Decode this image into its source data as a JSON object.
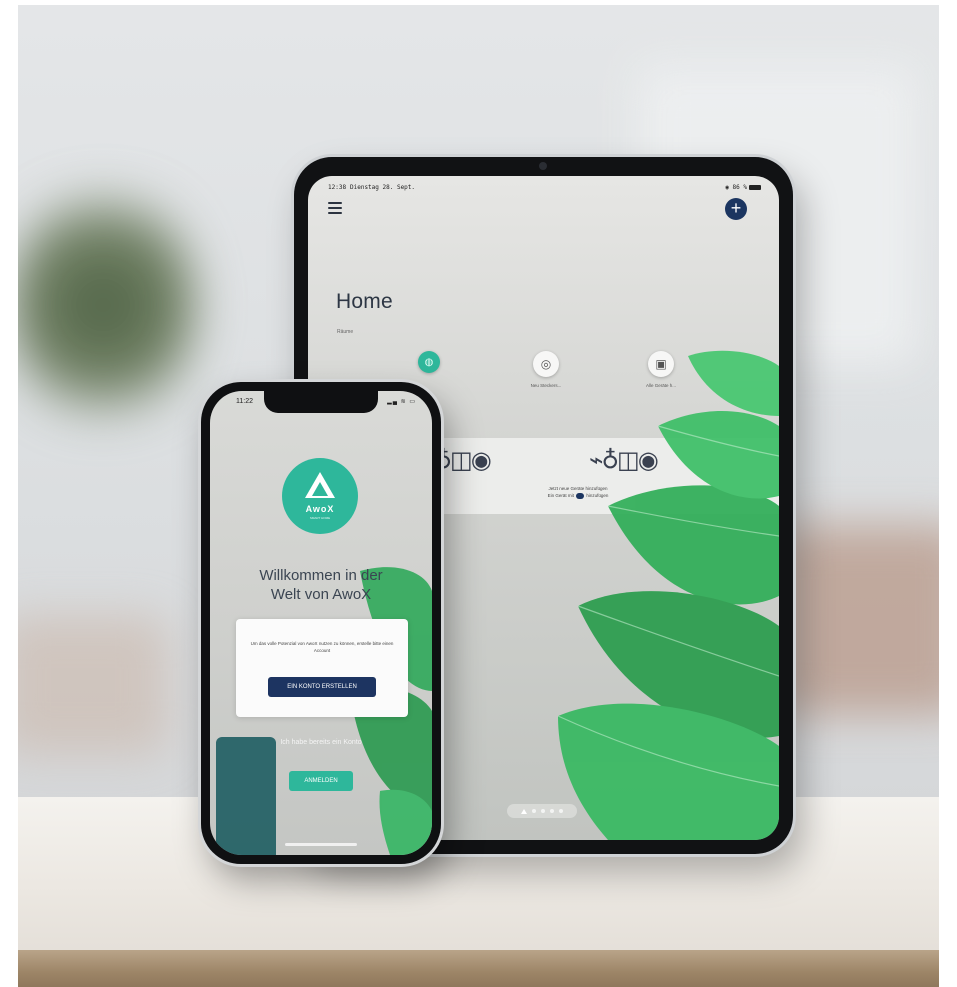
{
  "tablet": {
    "status": {
      "time": "12:38",
      "date": "Dienstag 28. Sept.",
      "icons": "◉ 86 %"
    },
    "header": {
      "menu_icon": "hamburger-menu-icon",
      "add_icon": "plus-icon",
      "add_symbol": "+"
    },
    "home": {
      "title": "Home",
      "subtitle": "Räume"
    },
    "devices": [
      {
        "icon": "light-bulb-icon",
        "label": ""
      },
      {
        "icon": "smart-plug-icon",
        "label": "Neu Steckers..."
      },
      {
        "icon": "camera-icon",
        "label": "Alle Geräte h..."
      }
    ],
    "add_device_prompt": {
      "line1": "Jetzt neue Geräte hinzufügen",
      "line2a": "Ein Gerät mit",
      "line2b": "hinzufügen"
    },
    "illustrations": {
      "left": "🔌💡◎◉",
      "right": "🔌💡◎◉"
    },
    "page_indicator": {
      "count": 5,
      "active": 0
    }
  },
  "phone": {
    "status": {
      "time": "11:22",
      "icons": "▂▄ ≋ ▭"
    },
    "logo": {
      "word": "AwoX",
      "tagline": "SMART HOME"
    },
    "welcome": {
      "line1": "Willkommen in der",
      "line2": "Welt von AwoX"
    },
    "card": {
      "text": "Um das volle Potenzial von AwoX nutzen zu können, erstelle bitte einen Account",
      "create_account_label": "EIN KONTO ERSTELLEN"
    },
    "existing_account": "Ich habe bereits ein Konto",
    "login_label": "ANMELDEN"
  },
  "colors": {
    "teal": "#2eb79b",
    "navy": "#1d3461",
    "text_dark": "#3b4552"
  }
}
